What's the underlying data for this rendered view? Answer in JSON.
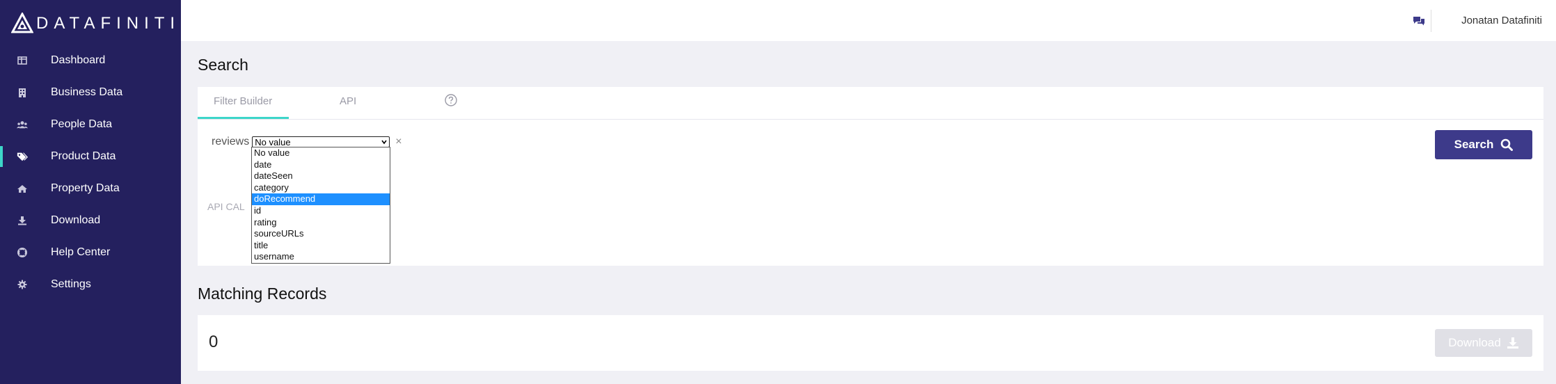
{
  "brand": {
    "name": "DATAFINITI"
  },
  "sidebar": {
    "items": [
      {
        "label": "Dashboard",
        "icon": "dashboard-icon"
      },
      {
        "label": "Business Data",
        "icon": "building-icon"
      },
      {
        "label": "People Data",
        "icon": "people-icon"
      },
      {
        "label": "Product Data",
        "icon": "tags-icon",
        "active": true
      },
      {
        "label": "Property Data",
        "icon": "home-icon"
      },
      {
        "label": "Download",
        "icon": "download-icon"
      },
      {
        "label": "Help Center",
        "icon": "lifebuoy-icon"
      },
      {
        "label": "Settings",
        "icon": "gear-icon"
      }
    ]
  },
  "topbar": {
    "user": "Jonatan Datafiniti"
  },
  "search": {
    "title": "Search",
    "tabs": [
      "Filter Builder",
      "API"
    ],
    "filter_label": "reviews",
    "select_value": "No value",
    "remove": "×",
    "options": [
      "No value",
      "date",
      "dateSeen",
      "category",
      "doRecommend",
      "id",
      "rating",
      "sourceURLs",
      "title",
      "username"
    ],
    "highlighted_option": "doRecommend",
    "api_call_label": "API CAL",
    "button": "Search"
  },
  "matching": {
    "title": "Matching Records",
    "count": "0",
    "button": "Download"
  },
  "colors": {
    "sidebar": "#24205e",
    "accent": "#3dd6c9",
    "primary": "#3d3a8a"
  }
}
